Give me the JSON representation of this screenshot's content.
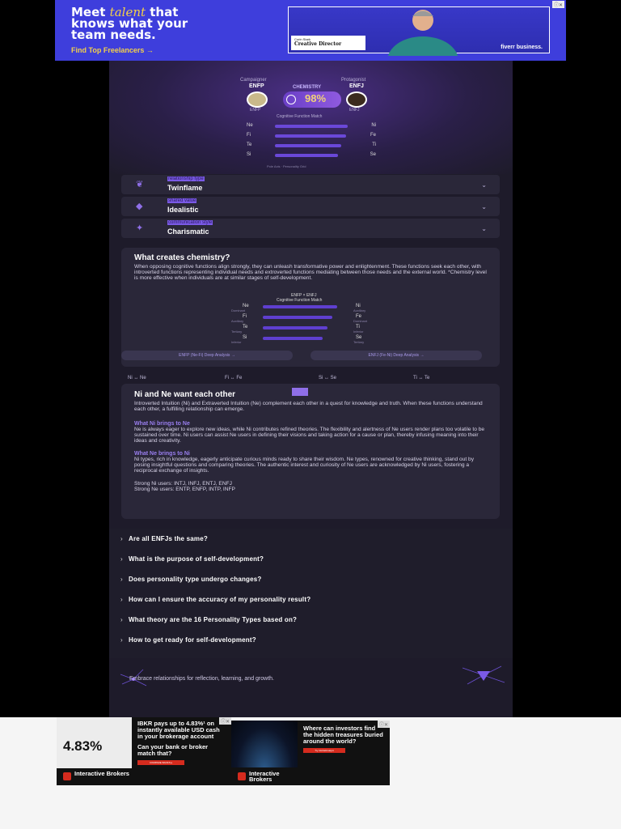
{
  "ad_top": {
    "line1_a": "Meet ",
    "line1_em": "talent",
    "line1_b": " that",
    "line2": "knows what your",
    "line3": "team needs.",
    "cta": "Find Top Freelancers →",
    "card_name": "Corin Stark",
    "card_role": "Creative Director",
    "brand": "fiverr business."
  },
  "hero": {
    "left_role": "Campaigner",
    "left_type": "ENFP",
    "chem_label": "CHEMISTRY",
    "chem_pct": "98%",
    "right_role": "Protagonist",
    "right_type": "ENFJ",
    "match_label": "Cognitive Function Match",
    "functions": [
      {
        "left": "Ne",
        "right": "Ni",
        "strength": 0.9
      },
      {
        "left": "Fi",
        "right": "Fe",
        "strength": 0.88
      },
      {
        "left": "Te",
        "right": "Ti",
        "strength": 0.82
      },
      {
        "left": "Si",
        "right": "Se",
        "strength": 0.78
      }
    ],
    "footnote": "Pole Axis · Personality Grid"
  },
  "traits": [
    {
      "caption": "relationship type",
      "value": "Twinflame",
      "icon": "heart-wings-icon"
    },
    {
      "caption": "shared value",
      "value": "Idealistic",
      "icon": "gem-icon"
    },
    {
      "caption": "communication style",
      "value": "Charismatic",
      "icon": "sparkle-icon"
    }
  ],
  "chemistry": {
    "title": "What creates chemistry?",
    "body": "When opposing cognitive functions align strongly, they can unleash transformative power and enlightenment. These functions seek each other, with introverted functions representing individual needs and extroverted functions mediating between those needs and the external world. *Chemistry level is more effective when individuals are at similar stages of self-development.",
    "mini_header": "ENFP × ENFJ",
    "mini_sub": "Cognitive Function Match",
    "mini_rows": [
      {
        "left": "Ne",
        "left_role": "Dominant",
        "right": "Ni",
        "right_role": "Auxiliary"
      },
      {
        "left": "Fi",
        "left_role": "Auxiliary",
        "right": "Fe",
        "right_role": "Dominant"
      },
      {
        "left": "Te",
        "left_role": "Tertiary",
        "right": "Ti",
        "right_role": "Inferior"
      },
      {
        "left": "Si",
        "left_role": "Inferior",
        "right": "Se",
        "right_role": "Tertiary"
      }
    ],
    "btn_left": "ENFP (Ne-Fi) Deep Analysis →",
    "btn_right": "ENFJ (Fe-Ni) Deep Analysis →"
  },
  "pair_tabs": [
    "Ni ↔ Ne",
    "Fi ↔ Fe",
    "Si ↔ Se",
    "Ti ↔ Te"
  ],
  "ni_ne": {
    "title": "Ni and Ne want each other",
    "intro": "Introverted Intuition (Ni) and Extraverted Intuition (Ne) complement each other in a quest for knowledge and truth. When these functions understand each other, a fulfilling relationship can emerge.",
    "h1": "What Ni brings to Ne",
    "p1": "Ne is always eager to explore new ideas, while Ni contributes refined theories. The flexibility and alertness of Ne users render plans too volatile to be sustained over time. Ni users can assist Ne users in defining their visions and taking action for a cause or plan, thereby infusing meaning into their ideas and creativity.",
    "h2": "What Ne brings to Ni",
    "p2": "Ni types, rich in knowledge, eagerly anticipate curious minds ready to share their wisdom. Ne types, renowned for creative thinking, stand out by posing insightful questions and comparing theories. The authentic interest and curiosity of Ne users are acknowledged by Ni users, fostering a reciprocal exchange of insights.",
    "strong_ni": "Strong Ni users: INTJ, INFJ, ENTJ, ENFJ",
    "strong_ne": "Strong Ne users: ENTP, ENFP, INTP, INFP"
  },
  "faq": [
    "Are all ENFJs the same?",
    "What is the purpose of self-development?",
    "Does personality type undergo changes?",
    "How can I ensure the accuracy of my personality result?",
    "What theory are the 16 Personality Types based on?",
    "How to get ready for self-development?"
  ],
  "footer_tagline": "Embrace relationships for reflection, learning, and growth.",
  "ad_bottom_1": {
    "big": "4.83%",
    "headline": "IBKR pays up to 4.83%¹ on instantly available USD cash in your brokerage account",
    "question": "Can your bank or broker match that?",
    "button": "COMPARE BANKS ▸",
    "brand": "Interactive Brokers"
  },
  "ad_bottom_2": {
    "headline": "Where can investors find the hidden treasures buried around the world?",
    "button": "Try GlobalAnalyst",
    "brand": "Interactive Brokers"
  },
  "colors": {
    "accent": "#8f6fe8",
    "card_bg": "#2a2739",
    "page_bg": "#1e1b2a",
    "ad_blue": "#3e3edc",
    "ib_red": "#d52b1e"
  }
}
